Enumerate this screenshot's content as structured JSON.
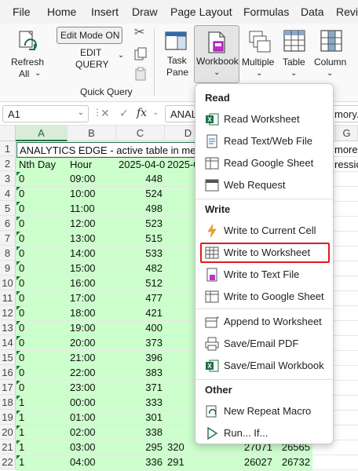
{
  "menu": [
    "File",
    "Home",
    "Insert",
    "Draw",
    "Page Layout",
    "Formulas",
    "Data",
    "Revi"
  ],
  "ribbon": {
    "refresh_label": "Refresh",
    "refresh_sub": "All",
    "edit_mode": "Edit Mode ON",
    "edit_query_1": "EDIT",
    "edit_query_2": "QUERY",
    "group_label": "Quick Query",
    "task_pane_1": "Task",
    "task_pane_2": "Pane",
    "workbook": "Workbook",
    "multiple": "Multiple",
    "table": "Table",
    "column": "Column"
  },
  "formula_bar": {
    "name_box": "A1",
    "fx": "fx",
    "content": "ANAL",
    "content_right": "mory."
  },
  "columns": [
    "A",
    "B",
    "C",
    "D",
    "G"
  ],
  "grid": {
    "row1_title": "ANALYTICS EDGE - active table in memo",
    "row1_right": "more",
    "row2": [
      "Nth Day",
      "Hour",
      "2025-04-0",
      "2025-0"
    ],
    "row2_right": "ressic",
    "row_numbers": [
      "1",
      "2",
      "3",
      "4",
      "5",
      "6",
      "7",
      "8",
      "9",
      "10",
      "11",
      "12",
      "13",
      "14",
      "15",
      "16",
      "17",
      "18",
      "19",
      "20",
      "21",
      "22"
    ],
    "rows": [
      [
        "0",
        "09:00",
        "448"
      ],
      [
        "0",
        "10:00",
        "524"
      ],
      [
        "0",
        "11:00",
        "498"
      ],
      [
        "0",
        "12:00",
        "523"
      ],
      [
        "0",
        "13:00",
        "515"
      ],
      [
        "0",
        "14:00",
        "533"
      ],
      [
        "0",
        "15:00",
        "482"
      ],
      [
        "0",
        "16:00",
        "512"
      ],
      [
        "0",
        "17:00",
        "477"
      ],
      [
        "0",
        "18:00",
        "421"
      ],
      [
        "0",
        "19:00",
        "400"
      ],
      [
        "0",
        "20:00",
        "373"
      ],
      [
        "0",
        "21:00",
        "396"
      ],
      [
        "0",
        "22:00",
        "383"
      ],
      [
        "0",
        "23:00",
        "371"
      ],
      [
        "1",
        "00:00",
        "333"
      ],
      [
        "1",
        "01:00",
        "301"
      ],
      [
        "1",
        "02:00",
        "338"
      ],
      [
        "1",
        "03:00",
        "295",
        "320",
        "27071",
        "26565"
      ],
      [
        "1",
        "04:00",
        "336",
        "291",
        "26027",
        "26732"
      ]
    ]
  },
  "dropdown": {
    "read_header": "Read",
    "read_items": [
      "Read Worksheet",
      "Read Text/Web File",
      "Read Google Sheet",
      "Web Request"
    ],
    "write_header": "Write",
    "write_items": [
      "Write to Current Cell",
      "Write to Worksheet",
      "Write to Text File",
      "Write to Google Sheet"
    ],
    "other_items": [
      "Append to Worksheet",
      "Save/Email PDF",
      "Save/Email Workbook"
    ],
    "other_header": "Other",
    "macro_items": [
      "New Repeat Macro",
      "Run... If..."
    ]
  },
  "colors": {
    "accent_green": "#1e7145",
    "cell_green": "#ccffcc",
    "highlight_red": "#e01b1b"
  }
}
